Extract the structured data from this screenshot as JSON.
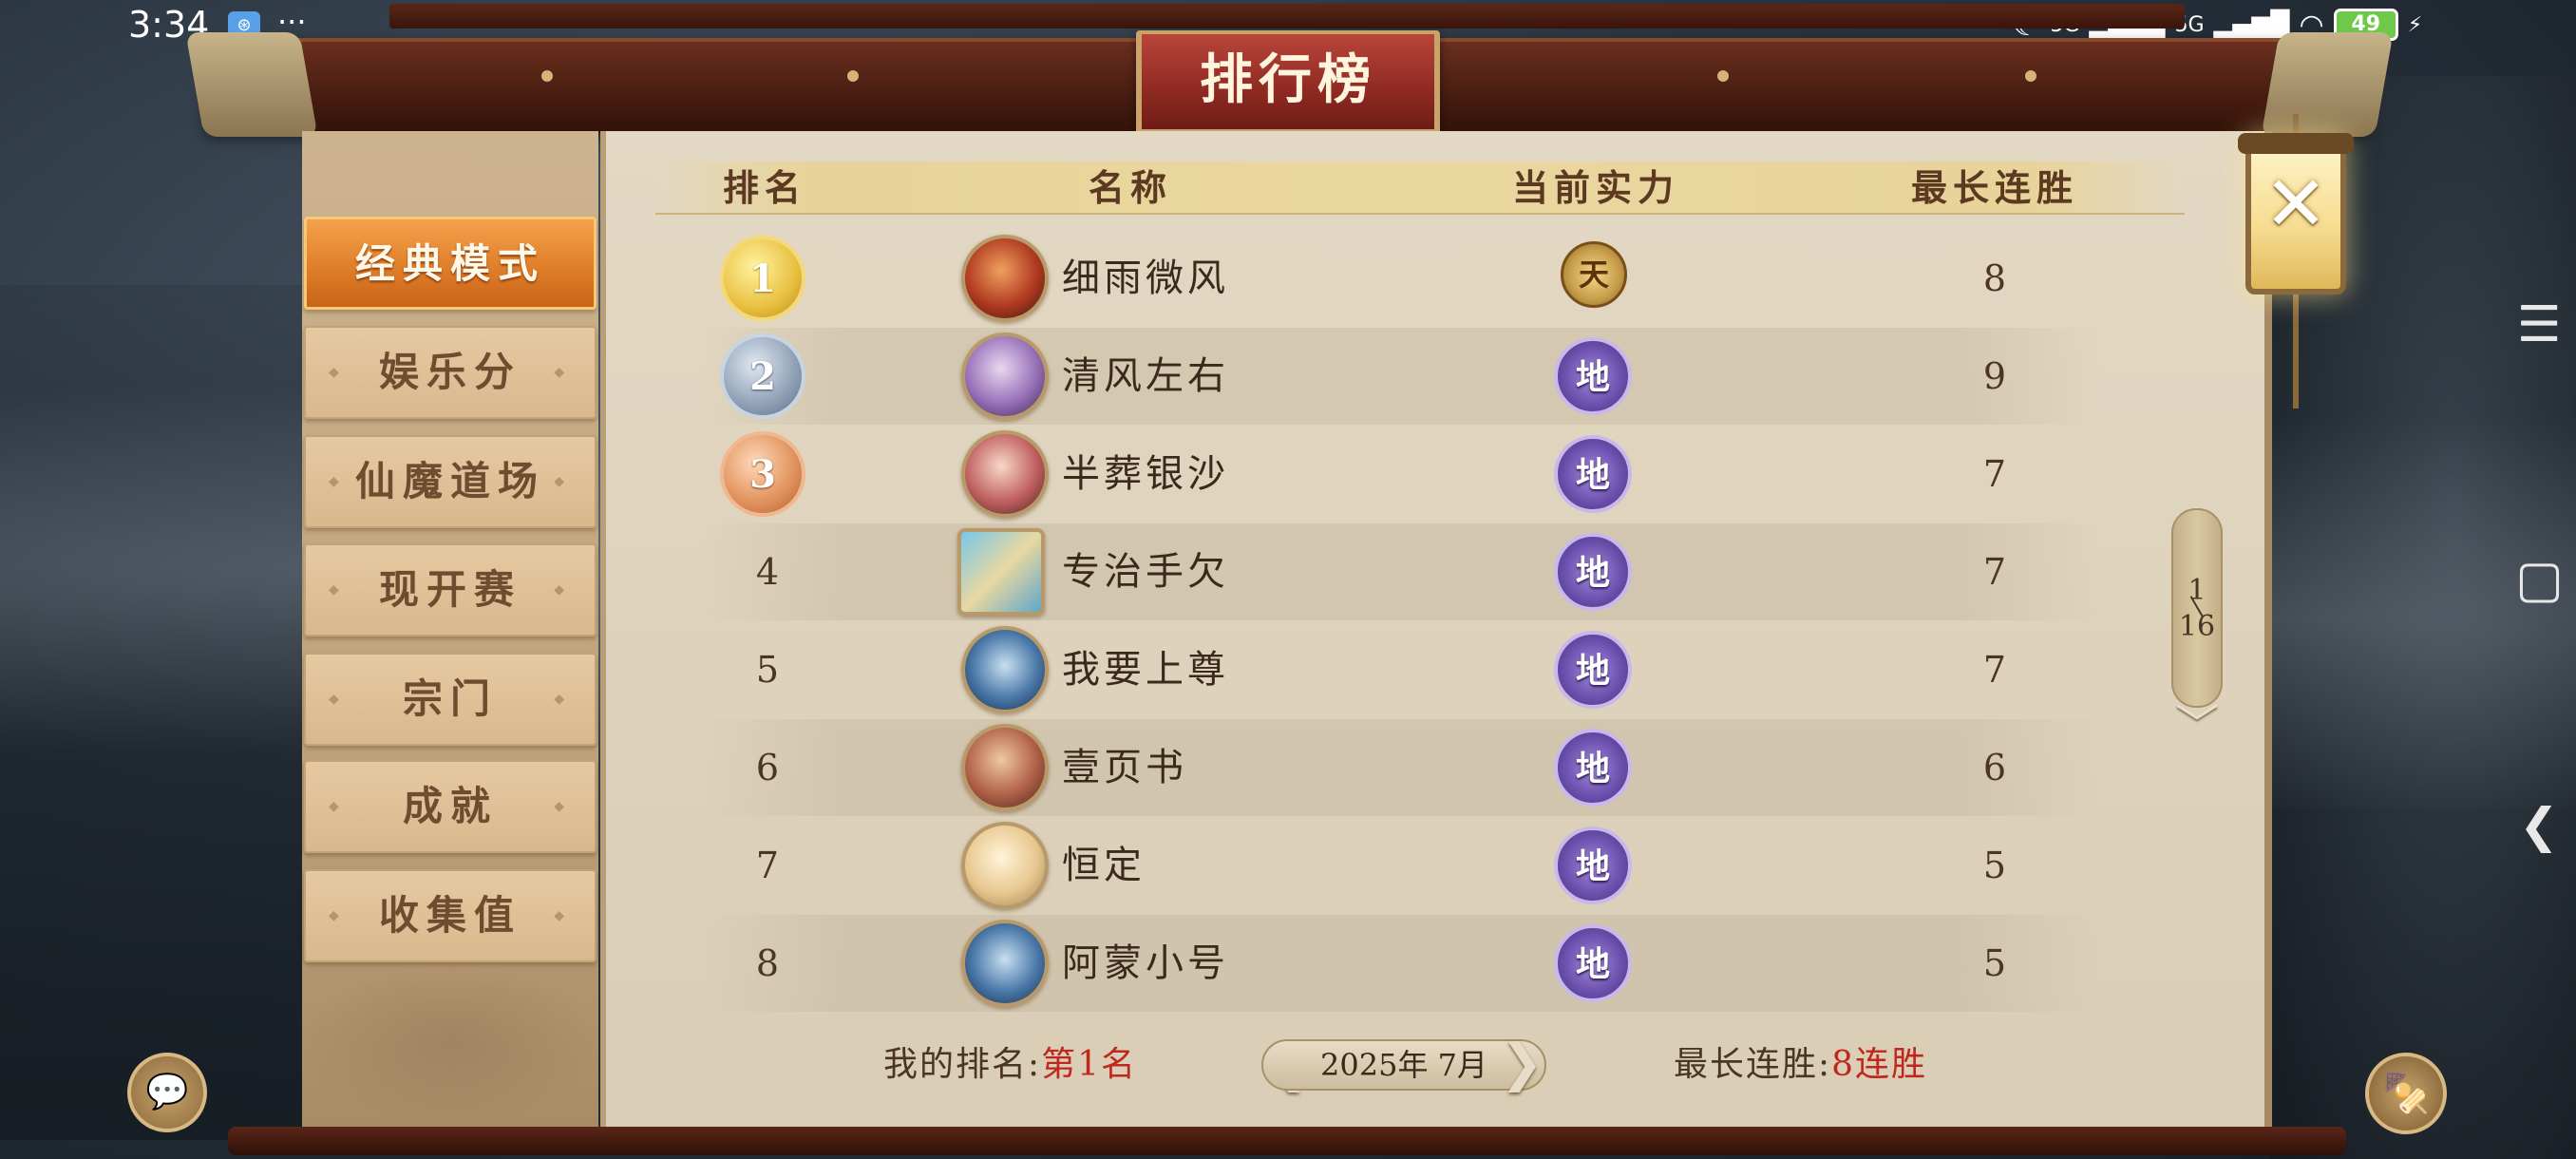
{
  "status_bar": {
    "time": "3:34",
    "app_icon": "⊛",
    "more": "···",
    "moon_icon": "☾",
    "net1": "5G",
    "net2": "5G",
    "wifi_icon": "wifi",
    "battery": "49",
    "charging_icon": "⚡"
  },
  "title": "排行榜",
  "sidebar": {
    "items": [
      {
        "label": "经典模式",
        "active": true
      },
      {
        "label": "娱乐分",
        "active": false
      },
      {
        "label": "仙魔道场",
        "active": false
      },
      {
        "label": "现开赛",
        "active": false
      },
      {
        "label": "宗门",
        "active": false
      },
      {
        "label": "成就",
        "active": false
      },
      {
        "label": "收集值",
        "active": false
      }
    ]
  },
  "table": {
    "headers": {
      "rank": "排名",
      "name": "名称",
      "power": "当前实力",
      "streak": "最长连胜"
    },
    "rows": [
      {
        "rank": "1",
        "name": "细雨微风",
        "power": "天",
        "streak": "8"
      },
      {
        "rank": "2",
        "name": "清风左右",
        "power": "地",
        "streak": "9"
      },
      {
        "rank": "3",
        "name": "半葬银沙",
        "power": "地",
        "streak": "7"
      },
      {
        "rank": "4",
        "name": "专治手欠",
        "power": "地",
        "streak": "7"
      },
      {
        "rank": "5",
        "name": "我要上尊",
        "power": "地",
        "streak": "7"
      },
      {
        "rank": "6",
        "name": "壹页书",
        "power": "地",
        "streak": "6"
      },
      {
        "rank": "7",
        "name": "恒定",
        "power": "地",
        "streak": "5"
      },
      {
        "rank": "8",
        "name": "阿蒙小号",
        "power": "地",
        "streak": "5"
      }
    ]
  },
  "pagination": {
    "current": "1",
    "total": "16",
    "up_icon": "︿",
    "down_icon": "﹀"
  },
  "footer": {
    "my_rank_label": "我的排名:",
    "my_rank_value": "第1名",
    "date": "2025年 7月",
    "prev_icon": "❮",
    "next_icon": "❯",
    "streak_label": "最长连胜:",
    "streak_value": "8连胜"
  },
  "close_icon": "✕",
  "chat_icon": "💬",
  "snack_icon": "🍢",
  "nav": {
    "menu_icon": "☰",
    "home_icon": "▢",
    "back_icon": "❮"
  },
  "colors": {
    "accent_orange": "#e07f2a",
    "highlight_red": "#c0281e",
    "di_purple": "#6e52b0",
    "tian_gold": "#caa14e"
  }
}
